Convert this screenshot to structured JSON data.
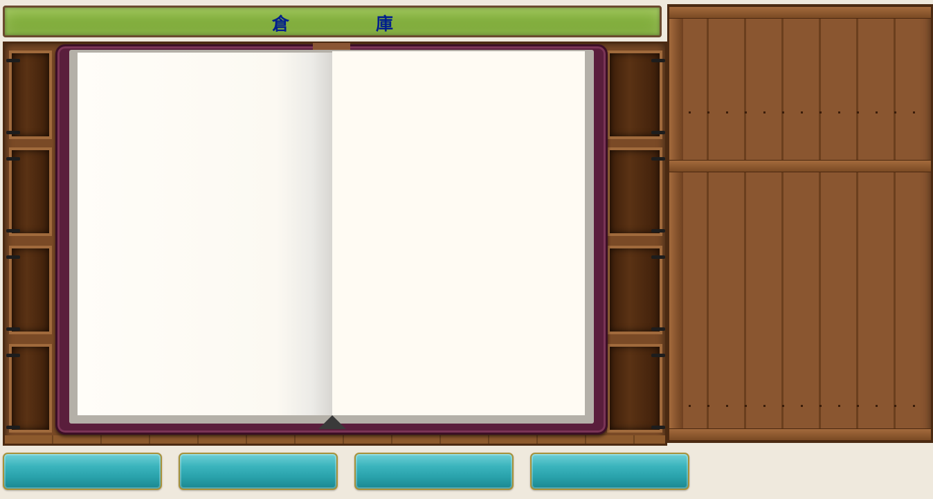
{
  "title": {
    "char1": "倉",
    "char2": "庫"
  },
  "colors": {
    "title_bar": "#84b03f",
    "title_text": "#001f8c",
    "book_cover": "#5a1e3c",
    "wood": "#8a5630",
    "button": "#2aa3ac"
  },
  "book": {
    "left_page_text": "",
    "right_page_text": ""
  },
  "buttons": [
    {
      "label": ""
    },
    {
      "label": ""
    },
    {
      "label": ""
    },
    {
      "label": ""
    }
  ]
}
